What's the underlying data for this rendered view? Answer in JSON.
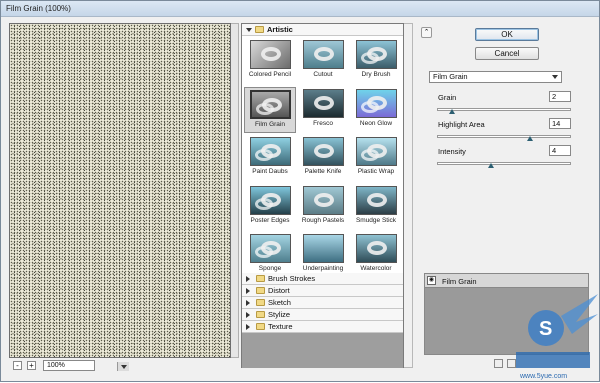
{
  "window": {
    "title": "Film Grain (100%)"
  },
  "preview": {
    "zoom": "100%",
    "zoom_out_label": "-",
    "zoom_in_label": "+"
  },
  "gallery": {
    "open_category": "Artistic",
    "filters": [
      {
        "label": "Colored Pencil",
        "selected": false
      },
      {
        "label": "Cutout",
        "selected": false
      },
      {
        "label": "Dry Brush",
        "selected": false
      },
      {
        "label": "Film Grain",
        "selected": true
      },
      {
        "label": "Fresco",
        "selected": false
      },
      {
        "label": "Neon Glow",
        "selected": false
      },
      {
        "label": "Paint Daubs",
        "selected": false
      },
      {
        "label": "Palette Knife",
        "selected": false
      },
      {
        "label": "Plastic Wrap",
        "selected": false
      },
      {
        "label": "Poster Edges",
        "selected": false
      },
      {
        "label": "Rough Pastels",
        "selected": false
      },
      {
        "label": "Smudge Stick",
        "selected": false
      },
      {
        "label": "Sponge",
        "selected": false
      },
      {
        "label": "Underpainting",
        "selected": false
      },
      {
        "label": "Watercolor",
        "selected": false
      }
    ],
    "categories": [
      "Brush Strokes",
      "Distort",
      "Sketch",
      "Stylize",
      "Texture"
    ]
  },
  "buttons": {
    "ok": "OK",
    "cancel": "Cancel"
  },
  "filter_select": {
    "value": "Film Grain"
  },
  "params": [
    {
      "label": "Grain",
      "value": "2",
      "fraction": 0.1
    },
    {
      "label": "Highlight Area",
      "value": "14",
      "fraction": 0.7
    },
    {
      "label": "Intensity",
      "value": "4",
      "fraction": 0.4
    }
  ],
  "layers": {
    "items": [
      {
        "name": "Film Grain"
      }
    ]
  },
  "watermark": {
    "text": "www.5yue.com"
  }
}
